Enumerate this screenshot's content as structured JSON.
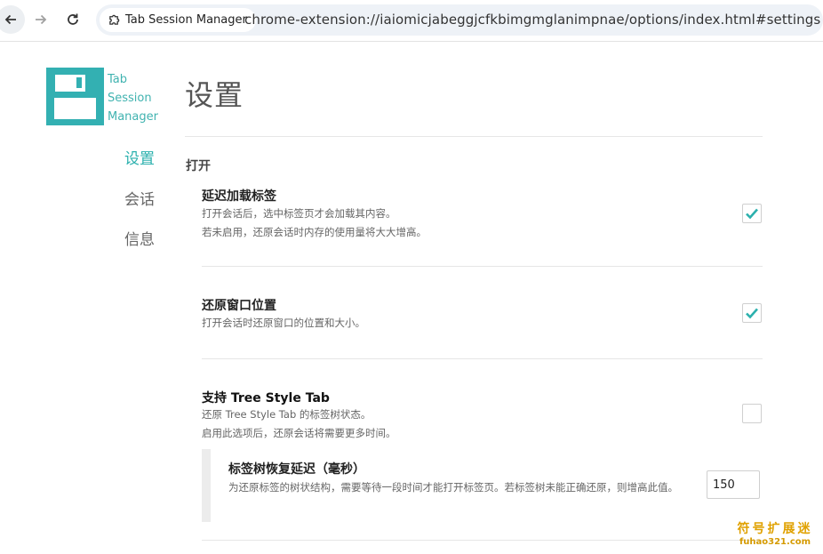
{
  "browser": {
    "extension_chip": "Tab Session Manager",
    "url": "chrome-extension://iaiomicjabeggjcfkbimgmglanimpnae/options/index.html#settings"
  },
  "brand": {
    "name_line1": "Tab",
    "name_line2": "Session",
    "name_line3": "Manager",
    "color": "#2bb0ad"
  },
  "sidebar": {
    "items": [
      {
        "label": "设置",
        "active": true
      },
      {
        "label": "会话",
        "active": false
      },
      {
        "label": "信息",
        "active": false
      }
    ]
  },
  "main": {
    "title": "设置",
    "section": "打开",
    "options": [
      {
        "title": "延迟加载标签",
        "desc1": "打开会话后，选中标签页才会加载其内容。",
        "desc2": "若未启用，还原会话时内存的使用量将大大增高。",
        "checked": true
      },
      {
        "title": "还原窗口位置",
        "desc1": "打开会话时还原窗口的位置和大小。",
        "checked": true
      },
      {
        "title": "支持 Tree Style Tab",
        "desc1": "还原 Tree Style Tab 的标签树状态。",
        "desc2": "启用此选项后，还原会话将需要更多时间。",
        "checked": false
      }
    ],
    "sub_option": {
      "title": "标签树恢复延迟（毫秒）",
      "desc": "为还原标签的树状结构，需要等待一段时间才能打开标签页。若标签树未能正确还原，则增高此值。",
      "value": "150"
    }
  },
  "watermark": {
    "line1": "符号扩展迷",
    "line2": "fuhao321.com"
  }
}
